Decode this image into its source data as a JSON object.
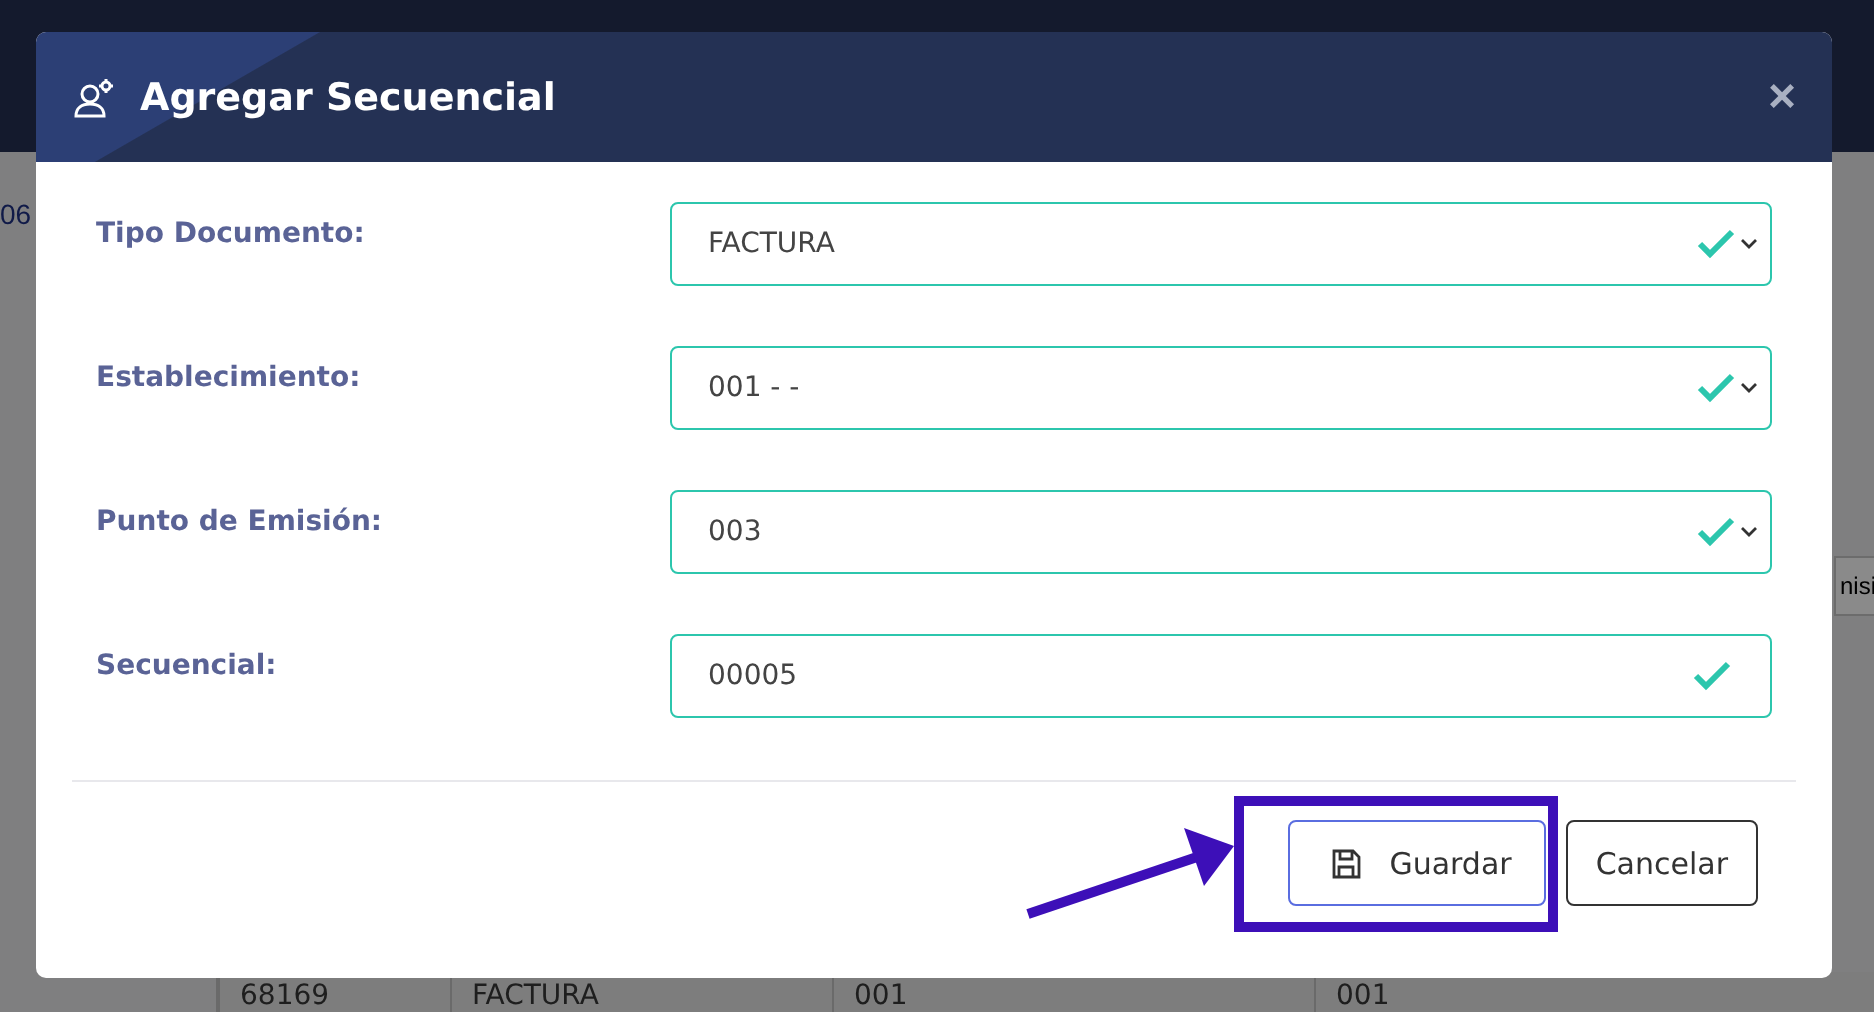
{
  "background": {
    "left_fragment": "06",
    "right_fragment": "nisi",
    "table_row": [
      "68169",
      "FACTURA",
      "001",
      "001"
    ]
  },
  "dialog": {
    "title": "Agregar Secuencial",
    "close_label": "×",
    "fields": [
      {
        "kind": "select",
        "label": "Tipo Documento:",
        "value": "FACTURA",
        "valid": true
      },
      {
        "kind": "select",
        "label": "Establecimiento:",
        "value": "001 - -",
        "valid": true
      },
      {
        "kind": "select",
        "label": "Punto de Emisión:",
        "value": "003",
        "valid": true
      },
      {
        "kind": "input",
        "label": "Secuencial:",
        "value": "00005",
        "valid": true
      }
    ],
    "buttons": [
      {
        "kind": "save",
        "label": "Guardar"
      },
      {
        "kind": "cancel",
        "label": "Cancelar"
      }
    ]
  },
  "annotation": {
    "highlighted": true
  }
}
